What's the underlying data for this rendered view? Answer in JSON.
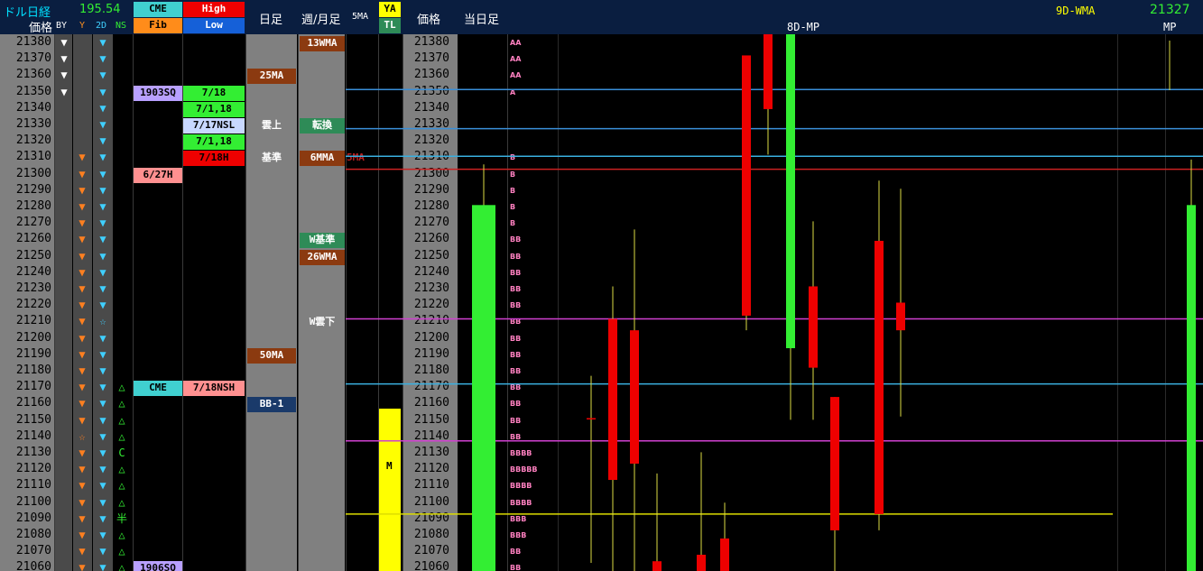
{
  "header": {
    "title": "ドル日経",
    "usdjpy": "195.54",
    "price_label": "価格",
    "col_by": "BY",
    "col_y": "Y",
    "col_2d": "2D",
    "col_ns": "NS",
    "cme": "CME",
    "fib": "Fib",
    "high": "High",
    "low": "Low",
    "daily": "日足",
    "weekly_monthly": "週/月足",
    "ma5": "5MA",
    "ya": "YA",
    "tl": "TL",
    "price_label2": "価格",
    "today": "当日足",
    "wma9d": "9D-WMA",
    "wma9d_value": "21327",
    "mp8d": "8D-MP",
    "mp": "MP"
  },
  "colors": {
    "header_bg": "#0a1e40",
    "gray_col": "#808080",
    "green": "#33ee33",
    "red": "#ee0000",
    "yellow": "#ffff00"
  },
  "prices": [
    "21380",
    "21370",
    "21360",
    "21350",
    "21340",
    "21330",
    "21320",
    "21310",
    "21300",
    "21290",
    "21280",
    "21270",
    "21260",
    "21250",
    "21240",
    "21230",
    "21220",
    "21210",
    "21200",
    "21190",
    "21180",
    "21170",
    "21160",
    "21150",
    "21140",
    "21130",
    "21120",
    "21110",
    "21100",
    "21090",
    "21080",
    "21070",
    "21060"
  ],
  "by_col": [
    "white-down",
    "white-down",
    "white-down",
    "white-down",
    "",
    "",
    "",
    "",
    "",
    "",
    "",
    "",
    "",
    "",
    "",
    "",
    "",
    "",
    "",
    "",
    "",
    "",
    "",
    "",
    "",
    "",
    "",
    "",
    "",
    "",
    "",
    "",
    ""
  ],
  "y_col": [
    "",
    "",
    "",
    "",
    "",
    "",
    "",
    "orange-down",
    "orange-down",
    "orange-down",
    "orange-down",
    "orange-down",
    "orange-down",
    "orange-down",
    "orange-down",
    "orange-down",
    "orange-down",
    "orange-down",
    "orange-down",
    "orange-down",
    "orange-down",
    "orange-down",
    "orange-down",
    "orange-down",
    "orange-star",
    "orange-down",
    "orange-down",
    "orange-down",
    "orange-down",
    "orange-down",
    "orange-down",
    "orange-down",
    "orange-down"
  ],
  "d2_col": [
    "cyan-down",
    "cyan-down",
    "cyan-down",
    "cyan-down",
    "cyan-down",
    "cyan-down",
    "cyan-down",
    "cyan-down",
    "cyan-down",
    "cyan-down",
    "cyan-down",
    "cyan-down",
    "cyan-down",
    "cyan-down",
    "cyan-down",
    "cyan-down",
    "cyan-down",
    "cyan-star",
    "cyan-down",
    "cyan-down",
    "cyan-down",
    "cyan-down",
    "cyan-down",
    "cyan-down",
    "cyan-down",
    "cyan-down",
    "cyan-down",
    "cyan-down",
    "cyan-down",
    "cyan-down",
    "cyan-down",
    "cyan-down",
    "cyan-down"
  ],
  "ns_col": [
    "",
    "",
    "",
    "",
    "",
    "",
    "",
    "",
    "",
    "",
    "",
    "",
    "",
    "",
    "",
    "",
    "",
    "",
    "",
    "",
    "",
    "△",
    "△",
    "△",
    "△",
    "C",
    "△",
    "△",
    "△",
    "半",
    "△",
    "△",
    "△"
  ],
  "cme_fib_labels": [
    {
      "row": 3,
      "text": "1903SQ",
      "bg": "#b8a0ff",
      "fg": "#000000"
    },
    {
      "row": 8,
      "text": "6/27H",
      "bg": "#ff9090",
      "fg": "#000000"
    },
    {
      "row": 21,
      "text": "CME",
      "bg": "#40d0d0",
      "fg": "#000000"
    },
    {
      "row": 32,
      "text": "1906SQ",
      "bg": "#b8a0ff",
      "fg": "#000000"
    }
  ],
  "high_low_labels": [
    {
      "row": 3,
      "text": "7/18",
      "bg": "#33ee33",
      "fg": "#000000"
    },
    {
      "row": 4,
      "text": "7/1,18",
      "bg": "#33ee33",
      "fg": "#000000"
    },
    {
      "row": 5,
      "text": "7/17NSL",
      "bg": "#c8d8ff",
      "fg": "#000000"
    },
    {
      "row": 6,
      "text": "7/1,18",
      "bg": "#33ee33",
      "fg": "#000000"
    },
    {
      "row": 7,
      "text": "7/18H",
      "bg": "#ee0000",
      "fg": "#000000"
    },
    {
      "row": 21,
      "text": "7/18NSH",
      "bg": "#ff9090",
      "fg": "#000000"
    }
  ],
  "daily_labels": [
    {
      "row": 2,
      "text": "25MA",
      "bg": "#8b3a10",
      "fg": "#ffffff"
    },
    {
      "row": 5,
      "text": "雲上",
      "bg": "",
      "fg": "#ffffff"
    },
    {
      "row": 7,
      "text": "基準",
      "bg": "",
      "fg": "#ffffff"
    },
    {
      "row": 19,
      "text": "50MA",
      "bg": "#8b3a10",
      "fg": "#ffffff"
    },
    {
      "row": 22,
      "text": "BB-1",
      "bg": "#1a3a6a",
      "fg": "#ffffff"
    }
  ],
  "weekly_labels": [
    {
      "row": 0,
      "text": "13WMA",
      "bg": "#8b3a10",
      "fg": "#ffffff"
    },
    {
      "row": 5,
      "text": "転換",
      "bg": "#2e8b57",
      "fg": "#ffffff"
    },
    {
      "row": 7,
      "text": "6MMA",
      "bg": "#8b3a10",
      "fg": "#ffffff"
    },
    {
      "row": 12,
      "text": "W基準",
      "bg": "#2e8b57",
      "fg": "#ffffff"
    },
    {
      "row": 13,
      "text": "26WMA",
      "bg": "#8b3a10",
      "fg": "#ffffff"
    },
    {
      "row": 17,
      "text": "W雲下",
      "bg": "",
      "fg": "#ffffff"
    }
  ],
  "ma5_overflow": "5MA",
  "ya_label": "M",
  "bb_marks": [
    "AA",
    "AA",
    "AA",
    "A",
    "",
    "",
    "",
    "B",
    "B",
    "B",
    "B",
    "B",
    "BB",
    "BB",
    "BB",
    "BB",
    "BB",
    "BB",
    "BB",
    "BB",
    "BB",
    "BB",
    "BB",
    "BB",
    "BB",
    "BBBB",
    "BBBBB",
    "BBBB",
    "BBBB",
    "BBB",
    "BBB",
    "BB",
    "BB"
  ],
  "chart_data": {
    "type": "candlestick",
    "ylim": [
      21055,
      21385
    ],
    "today_bar": {
      "open": 21280,
      "close": 21055,
      "high": 21305,
      "low": 21055
    },
    "candles": [
      {
        "open": 21149,
        "close": 21149,
        "high": 21175,
        "low": 21060
      },
      {
        "open": 21210,
        "close": 21111,
        "high": 21230,
        "low": 21055
      },
      {
        "open": 21203,
        "close": 21121,
        "high": 21265,
        "low": 21055
      },
      {
        "open": 21061,
        "close": 21055,
        "high": 21115,
        "low": 21055
      },
      {
        "open": 21065,
        "close": 21055,
        "high": 21128,
        "low": 21055
      },
      {
        "open": 21075,
        "close": 21055,
        "high": 21097,
        "low": 21055
      },
      {
        "open": 21385,
        "close": 21339,
        "high": 21385,
        "low": 21311
      },
      {
        "open": 21372,
        "close": 21212,
        "high": 21296,
        "low": 21203
      },
      {
        "open": 21192,
        "close": 21385,
        "high": 21385,
        "low": 21148
      },
      {
        "open": 21230,
        "close": 21180,
        "high": 21270,
        "low": 21148
      },
      {
        "open": 21162,
        "close": 21080,
        "high": 21162,
        "low": 21055
      },
      {
        "open": 21258,
        "close": 21090,
        "high": 21295,
        "low": 21080
      },
      {
        "open": 21220,
        "close": 21203,
        "high": 21290,
        "low": 21150
      },
      {
        "open": 21055,
        "close": 21280,
        "high": 21308,
        "low": 21055
      }
    ],
    "levels": [
      {
        "name": "9D-WMA",
        "value": 21327,
        "color": "#3a8fd8"
      },
      {
        "value": 21351,
        "color": "#3a8fd8"
      },
      {
        "value": 21310,
        "color": "#3ab0e0"
      },
      {
        "value": 21302,
        "color": "#cc2222"
      },
      {
        "value": 21210,
        "color": "#d040d0"
      },
      {
        "value": 21170,
        "color": "#3ab0e0"
      },
      {
        "value": 21135,
        "color": "#d040d0"
      },
      {
        "value": 21090,
        "color": "#dddd00"
      }
    ]
  }
}
